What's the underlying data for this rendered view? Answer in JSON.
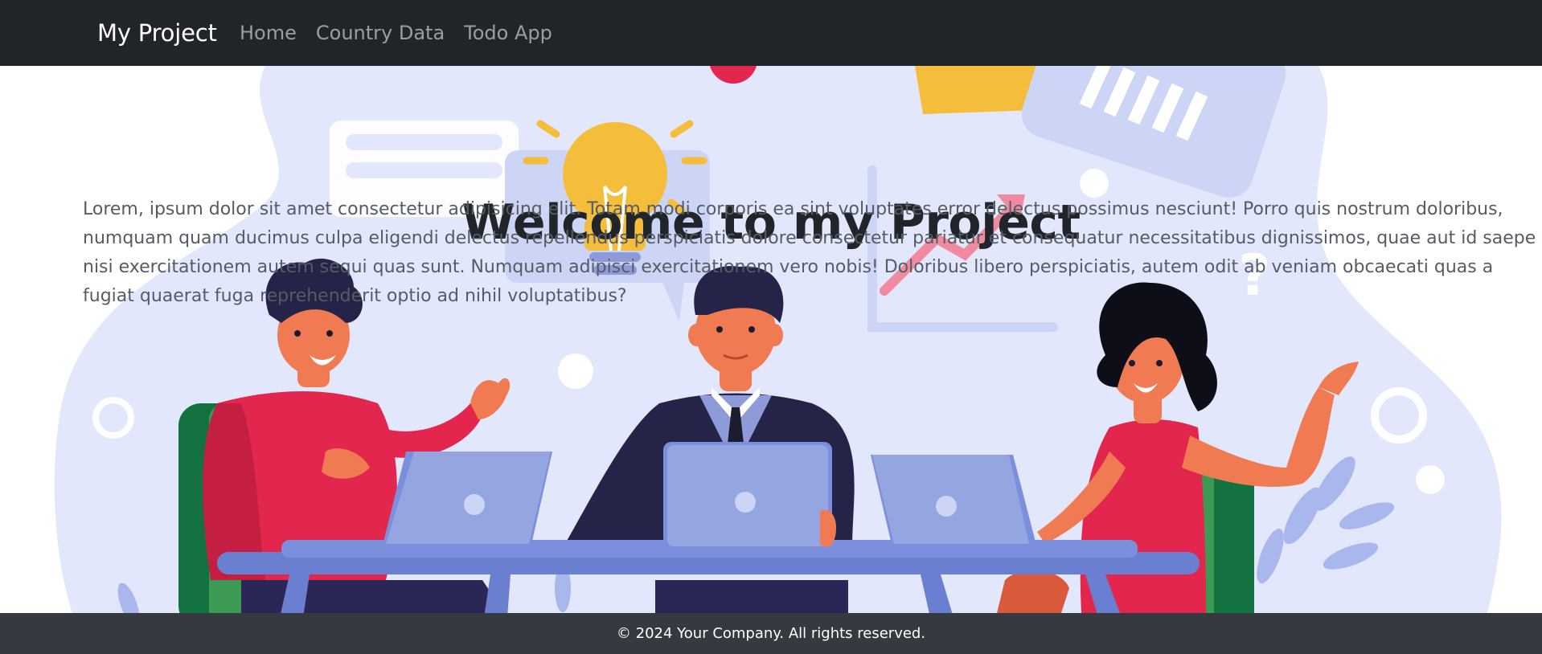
{
  "navbar": {
    "brand": "My Project",
    "links": [
      {
        "label": "Home"
      },
      {
        "label": "Country Data"
      },
      {
        "label": "Todo App"
      }
    ]
  },
  "hero": {
    "title": "Welcome to my Project",
    "paragraph": "Lorem, ipsum dolor sit amet consectetur adipisicing elit. Totam modi corporis ea sint voluptates error delectus possimus nesciunt! Porro quis nostrum doloribus, numquam quam ducimus culpa eligendi delectus repellendus perspiciatis dolore consectetur pariatur et consequatur necessitatibus dignissimos, quae aut id saepe nisi exercitationem autem sequi quas sunt. Numquam adipisci exercitationem vero nobis! Doloribus libero perspiciatis, autem odit ab veniam obcaecati quas a fugiat quaerat fuga reprehenderit optio ad nihil voluptatibus?"
  },
  "footer": {
    "text": "© 2024 Your Company. All rights reserved."
  },
  "colors": {
    "navbar_bg": "#212529",
    "footer_bg": "#343a40",
    "illustration_bg": "#e3e7fb"
  }
}
